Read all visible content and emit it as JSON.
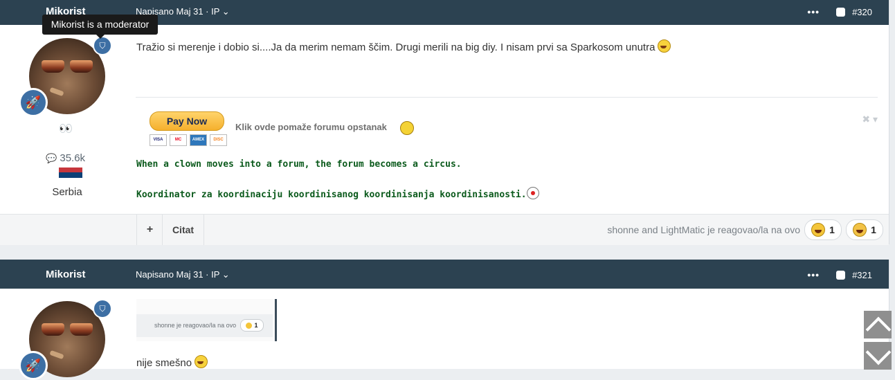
{
  "tooltip": {
    "text": "Mikorist is a moderator"
  },
  "posts": [
    {
      "author": "Mikorist",
      "meta": "Napisano Maj 31 · IP",
      "number": "#320",
      "author_emoji": "👀",
      "post_count": "35.6k",
      "country": "Serbia",
      "flag_colors": [
        "#c6363c",
        "#0c4076",
        "#ffffff"
      ],
      "text": "Tražio si merenje i dobio si....Ja da merim nemam ščim. Drugi merili na big diy. I nisam prvi sa Sparkosom unutra",
      "signature": {
        "paypal_button": "Pay Now",
        "cards": [
          "VISA",
          "MC",
          "AMEX",
          "DISC"
        ],
        "link": "Klik ovde pomaže forumu opstanak",
        "line1": "When a clown moves into a forum, the forum becomes a circus.",
        "line2": "Koordinator za koordinaciju koordinisanog koordinisanja koordinisanosti."
      },
      "controls": {
        "plus": "+",
        "quote": "Citat",
        "reactions_text": "shonne and LightMatic je reagovao/la na ovo",
        "reactions": [
          {
            "icon": "laughing-face-icon",
            "count": "1"
          },
          {
            "icon": "tears-of-joy-icon",
            "count": "1"
          }
        ]
      }
    },
    {
      "author": "Mikorist",
      "meta": "Napisano Maj 31 · IP",
      "number": "#321",
      "quote_image": {
        "text": "shonne je reagovao/la na ovo",
        "count": "1"
      },
      "text": "nije smešno"
    }
  ],
  "colors": {
    "header_bg": "#2c4251",
    "accent_blue": "#3d6fa4",
    "signature_green": "#0b5a1c"
  }
}
